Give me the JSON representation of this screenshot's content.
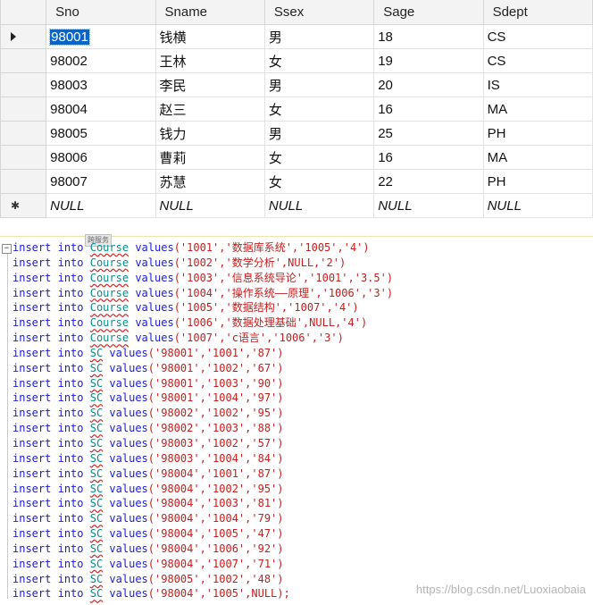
{
  "grid": {
    "columns": [
      "Sno",
      "Sname",
      "Ssex",
      "Sage",
      "Sdept"
    ],
    "rows": [
      [
        "98001",
        "钱横",
        "男",
        "18",
        "CS"
      ],
      [
        "98002",
        "王林",
        "女",
        "19",
        "CS"
      ],
      [
        "98003",
        "李民",
        "男",
        "20",
        "IS"
      ],
      [
        "98004",
        "赵三",
        "女",
        "16",
        "MA"
      ],
      [
        "98005",
        "钱力",
        "男",
        "25",
        "PH"
      ],
      [
        "98006",
        "曹莉",
        "女",
        "16",
        "MA"
      ],
      [
        "98007",
        "苏慧",
        "女",
        "22",
        "PH"
      ]
    ],
    "new_row": [
      "NULL",
      "NULL",
      "NULL",
      "NULL",
      "NULL"
    ],
    "selected_cell": "98001",
    "current_row_icon": "arrow-right-icon",
    "new_row_icon": "asterisk-icon"
  },
  "editor": {
    "lines": [
      {
        "table": "Course",
        "values": "('1001','数据库系统','1005','4')"
      },
      {
        "table": "Course",
        "values": "('1002','数学分析',NULL,'2')"
      },
      {
        "table": "Course",
        "values": "('1003','信息系统导论','1001','3.5')"
      },
      {
        "table": "Course",
        "values": "('1004','操作系统——原理','1006','3')"
      },
      {
        "table": "Course",
        "values": "('1005','数据结构','1007','4')"
      },
      {
        "table": "Course",
        "values": "('1006','数据处理基础',NULL,'4')"
      },
      {
        "table": "Course",
        "values": "('1007','c语言','1006','3')"
      },
      {
        "table": "SC",
        "values": "('98001','1001','87')"
      },
      {
        "table": "SC",
        "values": "('98001','1002','67')"
      },
      {
        "table": "SC",
        "values": "('98001','1003','90')"
      },
      {
        "table": "SC",
        "values": "('98001','1004','97')"
      },
      {
        "table": "SC",
        "values": "('98002','1002','95')"
      },
      {
        "table": "SC",
        "values": "('98002','1003','88')"
      },
      {
        "table": "SC",
        "values": "('98003','1002','57')"
      },
      {
        "table": "SC",
        "values": "('98003','1004','84')"
      },
      {
        "table": "SC",
        "values": "('98004','1001','87')"
      },
      {
        "table": "SC",
        "values": "('98004','1002','95')"
      },
      {
        "table": "SC",
        "values": "('98004','1003','81')"
      },
      {
        "table": "SC",
        "values": "('98004','1004','79')"
      },
      {
        "table": "SC",
        "values": "('98004','1005','47')"
      },
      {
        "table": "SC",
        "values": "('98004','1006','92')"
      },
      {
        "table": "SC",
        "values": "('98004','1007','71')"
      },
      {
        "table": "SC",
        "values": "('98005','1002','48')"
      },
      {
        "table": "SC",
        "values": "('98004','1005',NULL);"
      }
    ],
    "kw_insert": "insert",
    "kw_into": "into",
    "kw_values": "values",
    "fold_glyph": "−",
    "tooltip": "跨服务",
    "watermark": "https://blog.csdn.net/Luoxiaobaia"
  }
}
